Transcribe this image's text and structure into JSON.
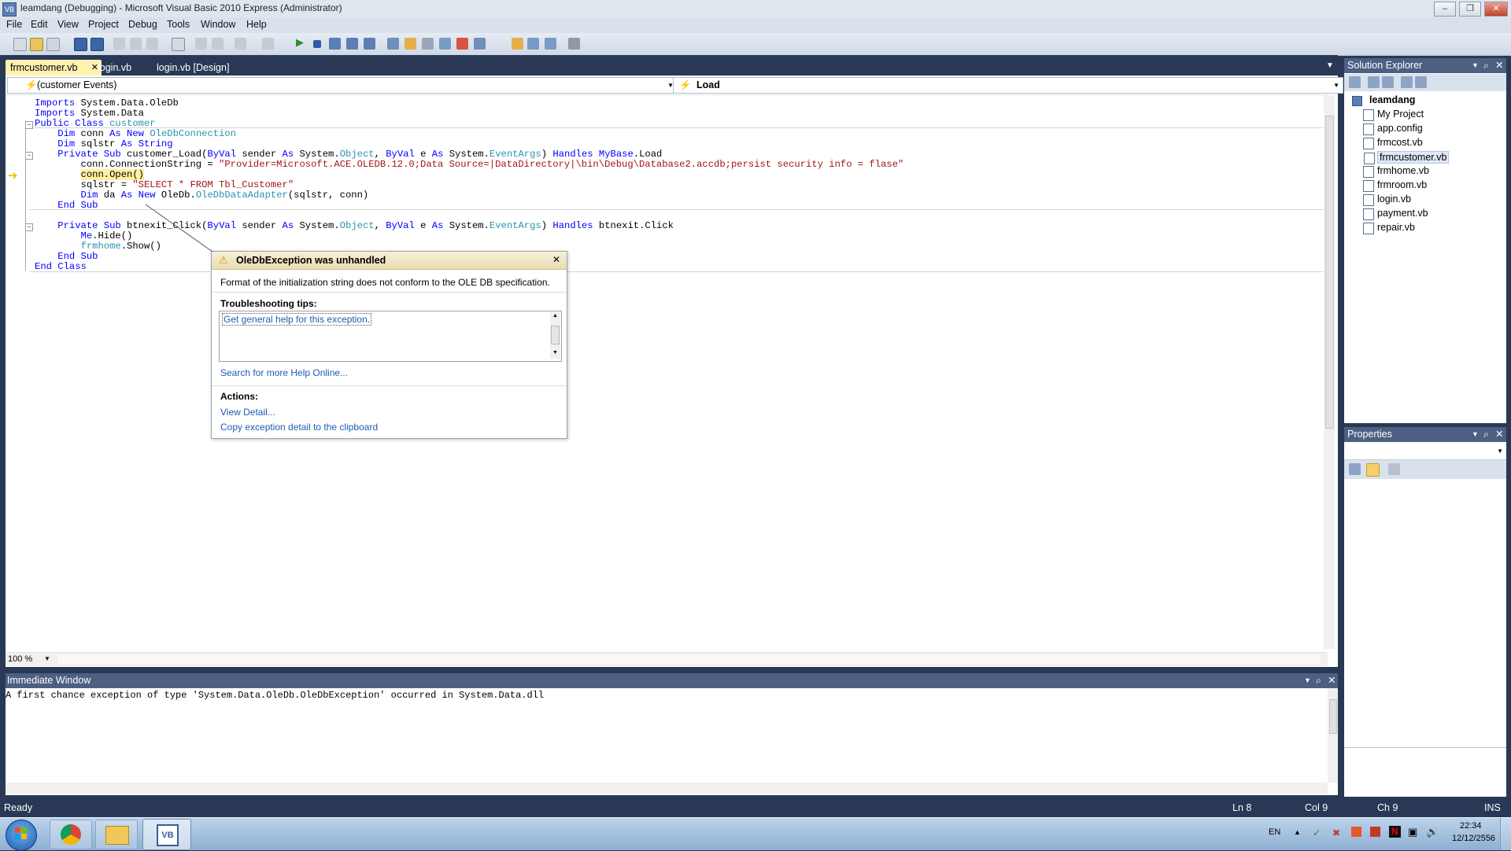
{
  "window": {
    "title": "leamdang (Debugging) - Microsoft Visual Basic 2010 Express (Administrator)",
    "app_icon_text": "VB"
  },
  "menu": [
    "File",
    "Edit",
    "View",
    "Project",
    "Debug",
    "Tools",
    "Window",
    "Help"
  ],
  "doc_tabs": [
    "frmcustomer.vb",
    "login.vb",
    "login.vb [Design]"
  ],
  "editor": {
    "class_dropdown": "(customer Events)",
    "method_dropdown": "Load",
    "zoom": "100 %",
    "lines": [
      {
        "segs": [
          {
            "t": "Imports",
            "c": "kw"
          },
          {
            "t": " System.Data.OleDb"
          }
        ]
      },
      {
        "segs": [
          {
            "t": "Imports",
            "c": "kw"
          },
          {
            "t": " System.Data"
          }
        ]
      },
      {
        "segs": [
          {
            "t": "Public Class",
            "c": "kw"
          },
          {
            "t": " "
          },
          {
            "t": "customer",
            "c": "ty"
          }
        ]
      },
      {
        "segs": [
          {
            "t": "    Dim",
            "c": "kw"
          },
          {
            "t": " conn "
          },
          {
            "t": "As New",
            "c": "kw"
          },
          {
            "t": " "
          },
          {
            "t": "OleDbConnection",
            "c": "ty"
          }
        ]
      },
      {
        "segs": [
          {
            "t": "    Dim",
            "c": "kw"
          },
          {
            "t": " sqlstr "
          },
          {
            "t": "As String",
            "c": "kw"
          }
        ]
      },
      {
        "segs": [
          {
            "t": "    Private Sub",
            "c": "kw"
          },
          {
            "t": " customer_Load("
          },
          {
            "t": "ByVal",
            "c": "kw"
          },
          {
            "t": " sender "
          },
          {
            "t": "As",
            "c": "kw"
          },
          {
            "t": " System."
          },
          {
            "t": "Object",
            "c": "ty"
          },
          {
            "t": ", "
          },
          {
            "t": "ByVal",
            "c": "kw"
          },
          {
            "t": " e "
          },
          {
            "t": "As",
            "c": "kw"
          },
          {
            "t": " System."
          },
          {
            "t": "EventArgs",
            "c": "ty"
          },
          {
            "t": ") "
          },
          {
            "t": "Handles",
            "c": "kw"
          },
          {
            "t": " "
          },
          {
            "t": "MyBase",
            "c": "kw"
          },
          {
            "t": ".Load"
          }
        ]
      },
      {
        "segs": [
          {
            "t": "        conn.ConnectionString = "
          },
          {
            "t": "\"Provider=Microsoft.ACE.OLEDB.12.0;Data Source=|DataDirectory|\\bin\\Debug\\Database2.accdb;persist security info = flase\"",
            "c": "st"
          }
        ]
      },
      {
        "segs": [
          {
            "t": "        "
          },
          {
            "t": "conn.Open()",
            "c": "hl"
          }
        ]
      },
      {
        "segs": [
          {
            "t": "        sqlstr = "
          },
          {
            "t": "\"SELECT * FROM Tbl_Customer\"",
            "c": "st"
          }
        ]
      },
      {
        "segs": [
          {
            "t": "        Dim",
            "c": "kw"
          },
          {
            "t": " da "
          },
          {
            "t": "As New",
            "c": "kw"
          },
          {
            "t": " OleDb."
          },
          {
            "t": "OleDbDataAdapter",
            "c": "ty"
          },
          {
            "t": "(sqlstr, conn)"
          }
        ]
      },
      {
        "segs": [
          {
            "t": "    End Sub",
            "c": "kw"
          }
        ]
      },
      {
        "segs": [
          {
            "t": ""
          }
        ]
      },
      {
        "segs": [
          {
            "t": "    Private Sub",
            "c": "kw"
          },
          {
            "t": " btnexit_Click("
          },
          {
            "t": "ByVal",
            "c": "kw"
          },
          {
            "t": " sender "
          },
          {
            "t": "As",
            "c": "kw"
          },
          {
            "t": " System."
          },
          {
            "t": "Object",
            "c": "ty"
          },
          {
            "t": ", "
          },
          {
            "t": "ByVal",
            "c": "kw"
          },
          {
            "t": " e "
          },
          {
            "t": "As",
            "c": "kw"
          },
          {
            "t": " System."
          },
          {
            "t": "EventArgs",
            "c": "ty"
          },
          {
            "t": ") "
          },
          {
            "t": "Handles",
            "c": "kw"
          },
          {
            "t": " btnexit.Click"
          }
        ]
      },
      {
        "segs": [
          {
            "t": "        "
          },
          {
            "t": "Me",
            "c": "kw"
          },
          {
            "t": ".Hide()"
          }
        ]
      },
      {
        "segs": [
          {
            "t": "        "
          },
          {
            "t": "frmhome",
            "c": "ty"
          },
          {
            "t": ".Show()"
          }
        ]
      },
      {
        "segs": [
          {
            "t": "    End Sub",
            "c": "kw"
          }
        ]
      },
      {
        "segs": [
          {
            "t": "End Class",
            "c": "kw"
          }
        ]
      }
    ]
  },
  "exception": {
    "title": "OleDbException was unhandled",
    "message": "Format of the initialization string does not conform to the OLE DB specification.",
    "tips_heading": "Troubleshooting tips:",
    "tip_link": "Get general help for this exception.",
    "search_link": "Search for more Help Online...",
    "actions_heading": "Actions:",
    "view_detail": "View Detail...",
    "copy_detail": "Copy exception detail to the clipboard"
  },
  "solution_explorer": {
    "title": "Solution Explorer",
    "project": "leamdang",
    "items": [
      "My Project",
      "app.config",
      "frmcost.vb",
      "frmcustomer.vb",
      "frmhome.vb",
      "frmroom.vb",
      "login.vb",
      "payment.vb",
      "repair.vb"
    ]
  },
  "properties": {
    "title": "Properties"
  },
  "immediate": {
    "title": "Immediate Window",
    "text": "A first chance exception of type 'System.Data.OleDb.OleDbException' occurred in System.Data.dll"
  },
  "status": {
    "ready": "Ready",
    "ln": "Ln 8",
    "col": "Col 9",
    "ch": "Ch 9",
    "ins": "INS"
  },
  "taskbar": {
    "lang": "EN",
    "time": "22:34",
    "date": "12/12/2556",
    "vb_label": "VB",
    "n_label": "N"
  },
  "colors": {
    "accent": "#293955",
    "tab_active": "#fff1b0",
    "keyword": "#0000ff",
    "type": "#2b91af",
    "string": "#a31515"
  }
}
